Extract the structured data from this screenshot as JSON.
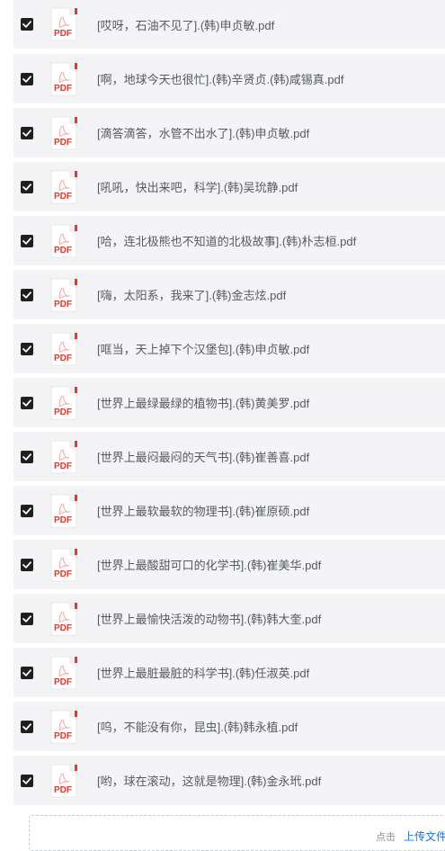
{
  "files": [
    {
      "name": "[哎呀，石油不见了].(韩)申贞敏.pdf",
      "checked": true,
      "icon": "pdf-icon",
      "icon_label": "PDF"
    },
    {
      "name": "[啊，地球今天也很忙].(韩)辛贤贞.(韩)咸锡真.pdf",
      "checked": true,
      "icon": "pdf-icon",
      "icon_label": "PDF"
    },
    {
      "name": "[滴答滴答，水管不出水了].(韩)申贞敏.pdf",
      "checked": true,
      "icon": "pdf-icon",
      "icon_label": "PDF"
    },
    {
      "name": "[吼吼，快出来吧，科学].(韩)吴玧静.pdf",
      "checked": true,
      "icon": "pdf-icon",
      "icon_label": "PDF"
    },
    {
      "name": "[哈，连北极熊也不知道的北极故事].(韩)朴志桓.pdf",
      "checked": true,
      "icon": "pdf-icon",
      "icon_label": "PDF"
    },
    {
      "name": "[嗨，太阳系，我来了].(韩)金志炫.pdf",
      "checked": true,
      "icon": "pdf-icon",
      "icon_label": "PDF"
    },
    {
      "name": "[哐当，天上掉下个汉堡包].(韩)申贞敏.pdf",
      "checked": true,
      "icon": "pdf-icon",
      "icon_label": "PDF"
    },
    {
      "name": "[世界上最绿最绿的植物书].(韩)黄美罗.pdf",
      "checked": true,
      "icon": "pdf-icon",
      "icon_label": "PDF"
    },
    {
      "name": "[世界上最闷最闷的天气书].(韩)崔善喜.pdf",
      "checked": true,
      "icon": "pdf-icon",
      "icon_label": "PDF"
    },
    {
      "name": "[世界上最软最软的物理书].(韩)崔原硕.pdf",
      "checked": true,
      "icon": "pdf-icon",
      "icon_label": "PDF"
    },
    {
      "name": "[世界上最酸甜可口的化学书].(韩)崔美华.pdf",
      "checked": true,
      "icon": "pdf-icon",
      "icon_label": "PDF"
    },
    {
      "name": "[世界上最愉快活泼的动物书].(韩)韩大奎.pdf",
      "checked": true,
      "icon": "pdf-icon",
      "icon_label": "PDF"
    },
    {
      "name": "[世界上最脏最脏的科学书].(韩)任淑英.pdf",
      "checked": true,
      "icon": "pdf-icon",
      "icon_label": "PDF"
    },
    {
      "name": "[呜，不能没有你，昆虫].(韩)韩永植.pdf",
      "checked": true,
      "icon": "pdf-icon",
      "icon_label": "PDF"
    },
    {
      "name": "[哟，球在滚动，这就是物理].(韩)金永玳.pdf",
      "checked": true,
      "icon": "pdf-icon",
      "icon_label": "PDF"
    }
  ],
  "upload": {
    "prefix": "点击",
    "link": "上传文件"
  },
  "colors": {
    "row_bg": "#f4f4f6",
    "checkbox": "#1f1f1f",
    "pdf_red": "#e8372c",
    "text": "#555a60",
    "link": "#1a73e8"
  }
}
